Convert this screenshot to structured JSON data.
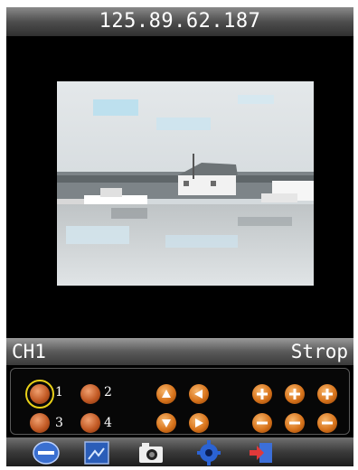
{
  "title": "125.89.62.187",
  "channel_bar": {
    "channel": "CH1",
    "stream": "Strop"
  },
  "channels": [
    {
      "label": "1",
      "selected": true
    },
    {
      "label": "2",
      "selected": false
    },
    {
      "label": "3",
      "selected": false
    },
    {
      "label": "4",
      "selected": false
    }
  ],
  "ptz": [
    "up-icon",
    "left-icon",
    "down-icon",
    "right-icon"
  ],
  "zoom": [
    "plus-icon",
    "plus-icon",
    "plus-icon",
    "minus-icon",
    "minus-icon",
    "minus-icon"
  ],
  "toolbar": [
    "live-view-icon",
    "gallery-icon",
    "snapshot-icon",
    "settings-icon",
    "exit-icon"
  ],
  "colors": {
    "accent": "#d8741c",
    "selection": "#e8d018",
    "toolbar_blue": "#2a5db8"
  }
}
